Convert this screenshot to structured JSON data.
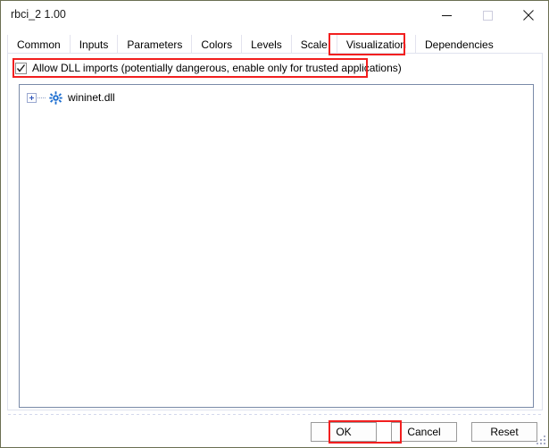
{
  "window": {
    "title": "rbci_2 1.00",
    "controls": {
      "minimize": "minimize-button",
      "maximize": "maximize-button",
      "close": "close-button"
    }
  },
  "tabs": [
    {
      "label": "Common",
      "active": false
    },
    {
      "label": "Inputs",
      "active": false
    },
    {
      "label": "Parameters",
      "active": false
    },
    {
      "label": "Colors",
      "active": false
    },
    {
      "label": "Levels",
      "active": false
    },
    {
      "label": "Scale",
      "active": false
    },
    {
      "label": "Visualization",
      "active": false
    },
    {
      "label": "Dependencies",
      "active": true
    }
  ],
  "dependencies_page": {
    "allow_dll": {
      "label": "Allow DLL imports (potentially dangerous, enable only for trusted applications)",
      "checked": true
    },
    "tree": {
      "items": [
        {
          "label": "wininet.dll",
          "icon": "gear-icon",
          "expander": "plus",
          "expanded": false
        }
      ]
    }
  },
  "footer": {
    "buttons": [
      {
        "label": "OK",
        "name": "ok-button",
        "highlighted": true
      },
      {
        "label": "Cancel",
        "name": "cancel-button",
        "highlighted": false
      },
      {
        "label": "Reset",
        "name": "reset-button",
        "highlighted": false
      }
    ]
  },
  "annotations": {
    "color": "#f21f1f",
    "targets": [
      "tab-dependencies",
      "allow-dll-checkbox-row",
      "ok-button"
    ]
  },
  "colors": {
    "window_border": "#6b6f52",
    "panel_border": "#dfe3ee",
    "listbox_border": "#7a8aa8",
    "accent_blue": "#2a51b8",
    "highlight_red": "#f21f1f"
  }
}
